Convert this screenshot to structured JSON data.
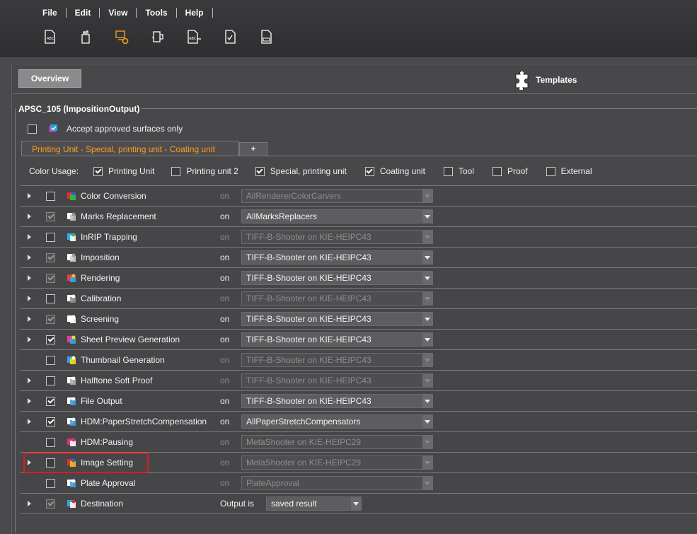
{
  "menu": [
    "File",
    "Edit",
    "View",
    "Tools",
    "Help"
  ],
  "toolbar": [
    {
      "icon": "text-document-icon"
    },
    {
      "icon": "hand-icon"
    },
    {
      "icon": "computer-gear-icon",
      "color": "#f0a020"
    },
    {
      "icon": "printer-tool-icon"
    },
    {
      "icon": "text-arrow-icon"
    },
    {
      "icon": "check-document-icon"
    },
    {
      "icon": "barcode-document-icon"
    }
  ],
  "overview": "Overview",
  "templates": "Templates",
  "section_title": "APSC_105 (ImpositionOutput)",
  "accept": {
    "label": "Accept approved surfaces only",
    "checked": false
  },
  "tabs": {
    "active": "Printing Unit  -  Special, printing unit  -  Coating unit",
    "add": "+"
  },
  "color_usage": {
    "label": "Color Usage:",
    "items": [
      {
        "label": "Printing Unit",
        "checked": true
      },
      {
        "label": "Printing unit 2",
        "checked": false
      },
      {
        "label": "Special, printing unit",
        "checked": true
      },
      {
        "label": "Coating unit",
        "checked": true
      },
      {
        "label": "Tool",
        "checked": false
      },
      {
        "label": "Proof",
        "checked": false
      },
      {
        "label": "External",
        "checked": false
      }
    ]
  },
  "stages": [
    {
      "name": "Color Conversion",
      "checked": false,
      "disabled": false,
      "active": false,
      "expand": true,
      "on": "on",
      "value": "AllRendererColorCarvers",
      "icon": "color-wheel-icon"
    },
    {
      "name": "Marks Replacement",
      "checked": true,
      "disabled": true,
      "active": true,
      "expand": true,
      "on": "on",
      "value": "AllMarksReplacers",
      "icon": "marks-icon"
    },
    {
      "name": "InRIP Trapping",
      "checked": false,
      "disabled": false,
      "active": false,
      "expand": true,
      "on": "on",
      "value": "TIFF-B-Shooter on KIE-HEIPC43",
      "icon": "trapping-icon"
    },
    {
      "name": "Imposition",
      "checked": true,
      "disabled": true,
      "active": true,
      "expand": true,
      "on": "on",
      "value": "TIFF-B-Shooter on KIE-HEIPC43",
      "icon": "imposition-icon"
    },
    {
      "name": "Rendering",
      "checked": true,
      "disabled": true,
      "active": true,
      "expand": true,
      "on": "on",
      "value": "TIFF-B-Shooter on KIE-HEIPC43",
      "icon": "rendering-icon"
    },
    {
      "name": "Calibration",
      "checked": false,
      "disabled": false,
      "active": false,
      "expand": true,
      "on": "on",
      "value": "TIFF-B-Shooter on KIE-HEIPC43",
      "icon": "calibration-icon"
    },
    {
      "name": "Screening",
      "checked": true,
      "disabled": true,
      "active": true,
      "expand": true,
      "on": "on",
      "value": "TIFF-B-Shooter on KIE-HEIPC43",
      "icon": "screening-icon"
    },
    {
      "name": "Sheet Preview Generation",
      "checked": true,
      "disabled": false,
      "active": true,
      "expand": true,
      "on": "on",
      "value": "TIFF-B-Shooter on KIE-HEIPC43",
      "icon": "sheet-preview-icon"
    },
    {
      "name": "Thumbnail Generation",
      "checked": false,
      "disabled": false,
      "active": false,
      "expand": false,
      "on": "on",
      "value": "TIFF-B-Shooter on KIE-HEIPC43",
      "icon": "thumbnail-icon"
    },
    {
      "name": "Halftone Soft Proof",
      "checked": false,
      "disabled": false,
      "active": false,
      "expand": true,
      "on": "on",
      "value": "TIFF-B-Shooter on KIE-HEIPC43",
      "icon": "soft-proof-icon"
    },
    {
      "name": "File Output",
      "checked": true,
      "disabled": false,
      "active": true,
      "expand": true,
      "on": "on",
      "value": "TIFF-B-Shooter on KIE-HEIPC43",
      "icon": "file-output-icon"
    },
    {
      "name": "HDM:PaperStretchCompensation",
      "checked": true,
      "disabled": false,
      "active": true,
      "expand": true,
      "on": "on",
      "value": "AllPaperStretchCompensators",
      "icon": "paper-stretch-icon"
    },
    {
      "name": "HDM:Pausing",
      "checked": false,
      "disabled": false,
      "active": false,
      "expand": false,
      "on": "on",
      "value": "MetaShooter on KIE-HEIPC29",
      "icon": "pausing-icon"
    },
    {
      "name": "Image Setting",
      "checked": false,
      "disabled": false,
      "active": false,
      "expand": true,
      "on": "on",
      "value": "MetaShooter on KIE-HEIPC29",
      "icon": "image-setting-icon",
      "highlighted": true
    },
    {
      "name": "Plate Approval",
      "checked": false,
      "disabled": false,
      "active": false,
      "expand": false,
      "on": "on",
      "value": "PlateApproval",
      "icon": "plate-approval-icon"
    }
  ],
  "destination": {
    "name": "Destination",
    "checked": true,
    "disabled": true,
    "output_label": "Output is",
    "value": "saved result",
    "icon": "destination-icon"
  },
  "colors": {
    "accent": "#ff9a1a",
    "highlight": "#e0191f"
  }
}
